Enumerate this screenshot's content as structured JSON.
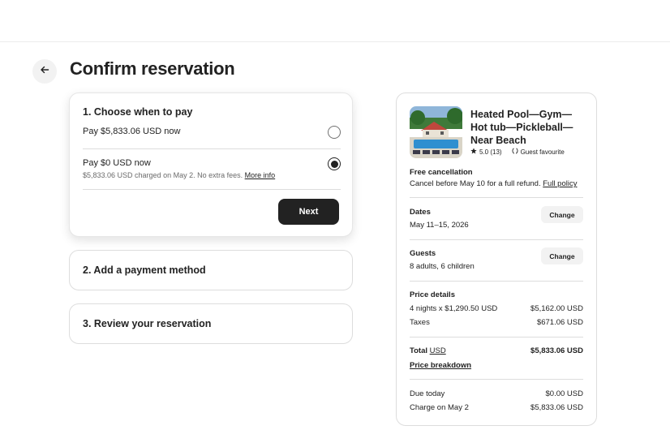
{
  "page": {
    "title": "Confirm reservation"
  },
  "steps": {
    "pay": {
      "title": "1. Choose when to pay",
      "options": [
        {
          "label": "Pay $5,833.06 USD now",
          "selected": false
        },
        {
          "label": "Pay $0 USD now",
          "sub": "$5,833.06 USD charged on May 2. No extra fees.",
          "link": "More info",
          "selected": true
        }
      ],
      "next_label": "Next"
    },
    "payment_method": {
      "title": "2. Add a payment method"
    },
    "review": {
      "title": "3. Review your reservation"
    }
  },
  "summary": {
    "listing_title": "Heated Pool—Gym—Hot tub—Pickleball—Near Beach",
    "rating": "5.0 (13)",
    "badge": "Guest favourite",
    "cancellation": {
      "title": "Free cancellation",
      "text": "Cancel before May 10 for a full refund.",
      "link": "Full policy"
    },
    "dates": {
      "label": "Dates",
      "value": "May 11–15, 2026",
      "change": "Change"
    },
    "guests": {
      "label": "Guests",
      "value": "8 adults, 6 children",
      "change": "Change"
    },
    "price": {
      "title": "Price details",
      "lines": [
        {
          "label": "4 nights x $1,290.50 USD",
          "amount": "$5,162.00 USD"
        },
        {
          "label": "Taxes",
          "amount": "$671.06 USD"
        }
      ],
      "total_label": "Total",
      "total_currency": "USD",
      "total_amount": "$5,833.06 USD",
      "breakdown_link": "Price breakdown",
      "due_today_label": "Due today",
      "due_today_amount": "$0.00 USD",
      "charge_label": "Charge on May 2",
      "charge_amount": "$5,833.06 USD"
    }
  },
  "icons": {
    "back": "arrow-left-icon",
    "star": "star-icon",
    "badge": "laurel-icon"
  },
  "colors": {
    "primary_dark": "#222222",
    "border": "#dddddd",
    "muted": "#6a6a6a"
  }
}
